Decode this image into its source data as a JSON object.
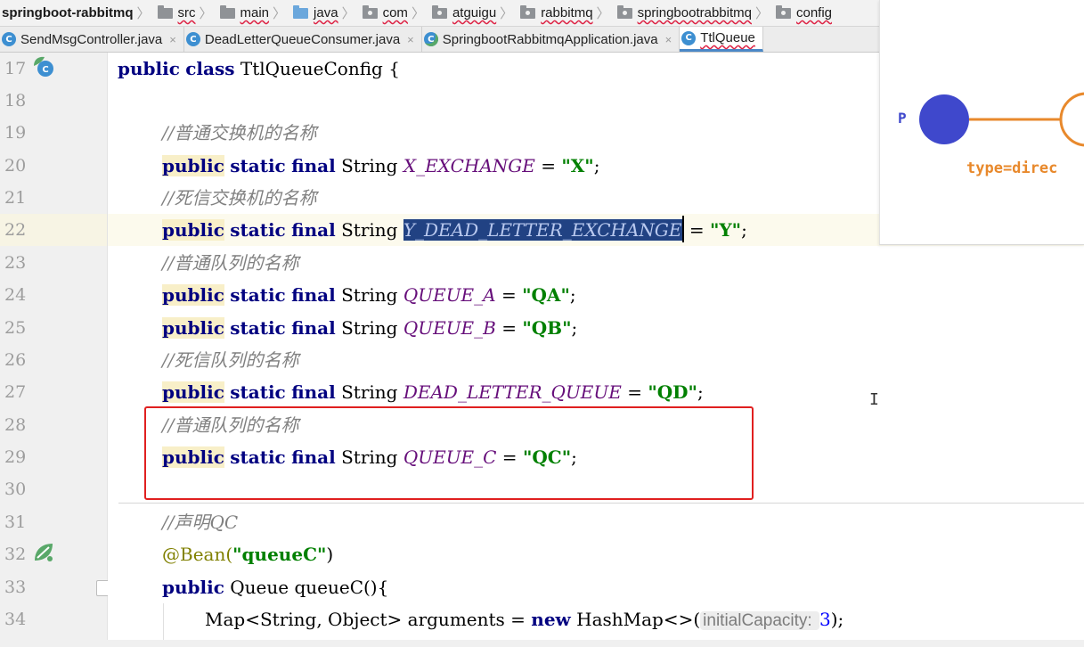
{
  "breadcrumb": {
    "project": "springboot-rabbitmq",
    "items": [
      "src",
      "main",
      "java",
      "com",
      "atguigu",
      "rabbitmq",
      "springbootrabbitmq",
      "config"
    ]
  },
  "tabs": [
    {
      "label": "SendMsgController.java",
      "icon": "class-icon",
      "close": "×"
    },
    {
      "label": "DeadLetterQueueConsumer.java",
      "icon": "class-icon",
      "close": "×"
    },
    {
      "label": "SpringbootRabbitmqApplication.java",
      "icon": "spring-class-icon",
      "close": "×"
    },
    {
      "label": "TtlQueue",
      "icon": "class-icon",
      "close": ""
    }
  ],
  "line_numbers": [
    "17",
    "18",
    "19",
    "20",
    "21",
    "22",
    "23",
    "24",
    "25",
    "26",
    "27",
    "28",
    "29",
    "30",
    "31",
    "32",
    "33",
    "34"
  ],
  "code": {
    "l17": {
      "public": "public",
      "class": "class",
      "name": "TtlQueueConfig {"
    },
    "l19": "//普通交换机的名称",
    "l20": {
      "const": "X_EXCHANGE",
      "value": "\"X\""
    },
    "l21": "//死信交换机的名称",
    "l22": {
      "const": "Y_DEAD_LETTER_EXCHANGE",
      "value": "\"Y\""
    },
    "l23": "//普通队列的名称",
    "l24": {
      "const": "QUEUE_A",
      "value": "\"QA\""
    },
    "l25": {
      "const": "QUEUE_B",
      "value": "\"QB\""
    },
    "l26": "//死信队列的名称",
    "l27": {
      "const": "DEAD_LETTER_QUEUE",
      "value": "\"QD\""
    },
    "l28": "//普通队列的名称",
    "l29": {
      "const": "QUEUE_C",
      "value": "\"QC\""
    },
    "l31": "//声明QC",
    "l32": {
      "annotation": "@Bean(",
      "value": "\"queueC\"",
      "close": ")"
    },
    "l33": {
      "public": "public",
      "type": "Queue",
      "method": "queueC(){"
    },
    "l34": {
      "lhs": "Map<String, Object> arguments = ",
      "new": "new",
      "ctor": "HashMap<>(",
      "hint_label": "initialCapacity:",
      "hint_value": "3",
      "end": ");"
    }
  },
  "keywords": {
    "public": "public",
    "static": "static",
    "final": "final",
    "type": "String",
    "eq": " = ",
    "semi": ";"
  },
  "diagram": {
    "producer_label": "P",
    "type_label": "type=direc"
  },
  "colors": {
    "keyword": "#000080",
    "comment": "#808080",
    "constant": "#660e7a",
    "string": "#008000",
    "highlight": "#e02020",
    "diagram_orange": "#e8892c",
    "diagram_blue": "#3f48cc"
  }
}
